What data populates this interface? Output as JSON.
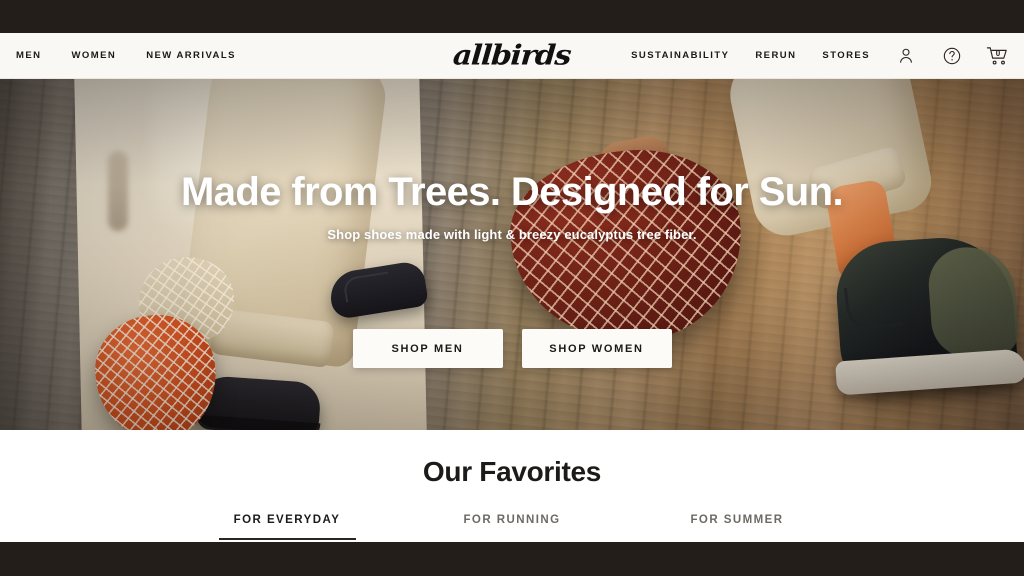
{
  "header": {
    "logo_text": "allbirds",
    "nav_left": [
      {
        "label": "MEN"
      },
      {
        "label": "WOMEN"
      },
      {
        "label": "NEW ARRIVALS"
      }
    ],
    "nav_right": [
      {
        "label": "SUSTAINABILITY"
      },
      {
        "label": "RERUN"
      },
      {
        "label": "STORES"
      }
    ],
    "icons": {
      "account": "user-icon",
      "help": "question-mark-circle-icon",
      "cart": "shopping-cart-icon"
    },
    "cart_count": "0"
  },
  "hero": {
    "title": "Made from Trees. Designed for Sun.",
    "subtitle": "Shop shoes made with light & breezy eucalyptus tree fiber.",
    "buttons": [
      {
        "label": "SHOP MEN"
      },
      {
        "label": "SHOP WOMEN"
      }
    ]
  },
  "favorites": {
    "heading": "Our Favorites",
    "tabs": [
      {
        "label": "FOR EVERYDAY",
        "active": true
      },
      {
        "label": "FOR RUNNING",
        "active": false
      },
      {
        "label": "FOR SUMMER",
        "active": false
      }
    ]
  },
  "colors": {
    "letterbox": "#241e1b",
    "header_bg": "#faf8f4",
    "text_dark": "#1d1916",
    "tab_inactive": "#6d6a66",
    "button_bg": "#fdfbf7"
  }
}
